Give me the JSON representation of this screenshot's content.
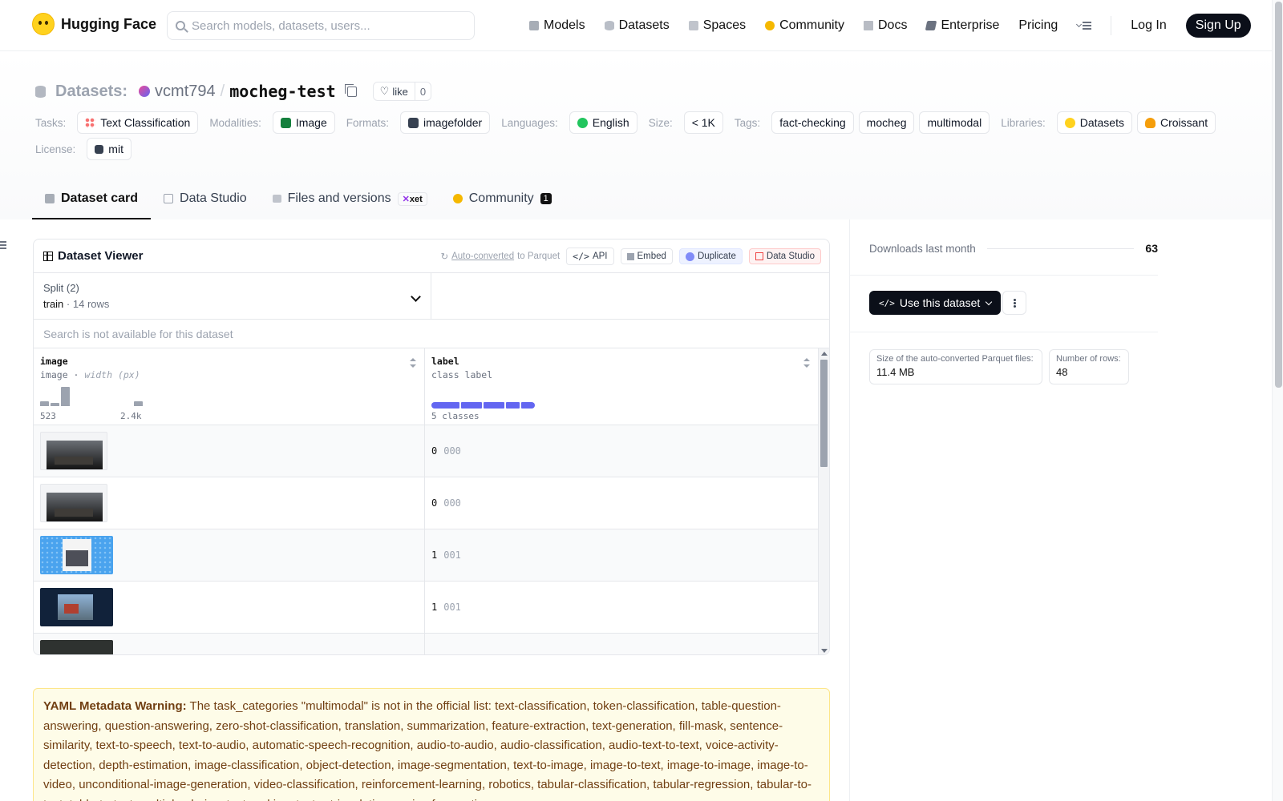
{
  "nav": {
    "brand": "Hugging Face",
    "search_placeholder": "Search models, datasets, users...",
    "links": [
      "Models",
      "Datasets",
      "Spaces",
      "Community",
      "Docs",
      "Enterprise",
      "Pricing"
    ],
    "login": "Log In",
    "signup": "Sign Up"
  },
  "header": {
    "section_label": "Datasets:",
    "owner": "vcmt794",
    "separator": "/",
    "repo": "mocheg-test",
    "like_label": "like",
    "like_count": "0",
    "tasks_label": "Tasks:",
    "task": "Text Classification",
    "modalities_label": "Modalities:",
    "modality": "Image",
    "formats_label": "Formats:",
    "format": "imagefolder",
    "languages_label": "Languages:",
    "language": "English",
    "size_label": "Size:",
    "size": "< 1K",
    "tags_label": "Tags:",
    "tags": [
      "fact-checking",
      "mocheg",
      "multimodal"
    ],
    "libraries_label": "Libraries:",
    "libraries": [
      "Datasets",
      "Croissant"
    ],
    "license_label": "License:",
    "license": "mit"
  },
  "tabs": {
    "dataset_card": "Dataset card",
    "data_studio": "Data Studio",
    "files": "Files and versions",
    "xet": "xet",
    "community": "Community",
    "community_count": "1"
  },
  "viewer": {
    "title": "Dataset Viewer",
    "auto_converted": "Auto-converted",
    "to_parquet": "to Parquet",
    "api": "API",
    "embed": "Embed",
    "duplicate": "Duplicate",
    "data_studio": "Data Studio",
    "split_label": "Split (2)",
    "split_name": "train",
    "split_dot": "·",
    "split_rows": "14 rows",
    "search_unavailable": "Search is not available for this dataset",
    "columns": [
      {
        "name": "image",
        "type": "image",
        "type_extra": "width (px)",
        "min": "523",
        "max": "2.4k"
      },
      {
        "name": "label",
        "type": "class label",
        "classes": "5 classes"
      }
    ],
    "histogram": [
      0.25,
      0.15,
      1.0,
      0.0,
      0.0,
      0.0,
      0.0,
      0.0,
      0.0,
      0.25
    ],
    "rows": [
      {
        "label": "0",
        "class": "000"
      },
      {
        "label": "0",
        "class": "000"
      },
      {
        "label": "1",
        "class": "001"
      },
      {
        "label": "1",
        "class": "001"
      }
    ]
  },
  "warning": {
    "title": "YAML Metadata Warning:",
    "text": "The task_categories \"multimodal\" is not in the official list: text-classification, token-classification, table-question-answering, question-answering, zero-shot-classification, translation, summarization, feature-extraction, text-generation, fill-mask, sentence-similarity, text-to-speech, text-to-audio, automatic-speech-recognition, audio-to-audio, audio-classification, audio-text-to-text, voice-activity-detection, depth-estimation, image-classification, object-detection, image-segmentation, text-to-image, image-to-text, image-to-image, image-to-video, unconditional-image-generation, video-classification, reinforcement-learning, robotics, tabular-classification, tabular-regression, tabular-to-text, table-to-text, multiple-choice, text-ranking, text-retrieval, time-series-forecasting"
  },
  "sidebar": {
    "downloads_label": "Downloads last month",
    "downloads": "63",
    "use_dataset": "Use this dataset",
    "parquet_size_label": "Size of the auto-converted Parquet files:",
    "parquet_size": "11.4 MB",
    "rows_label": "Number of rows:",
    "rows": "48"
  },
  "colors": {
    "accent": "#6366f1",
    "dark": "#0b0f19"
  }
}
